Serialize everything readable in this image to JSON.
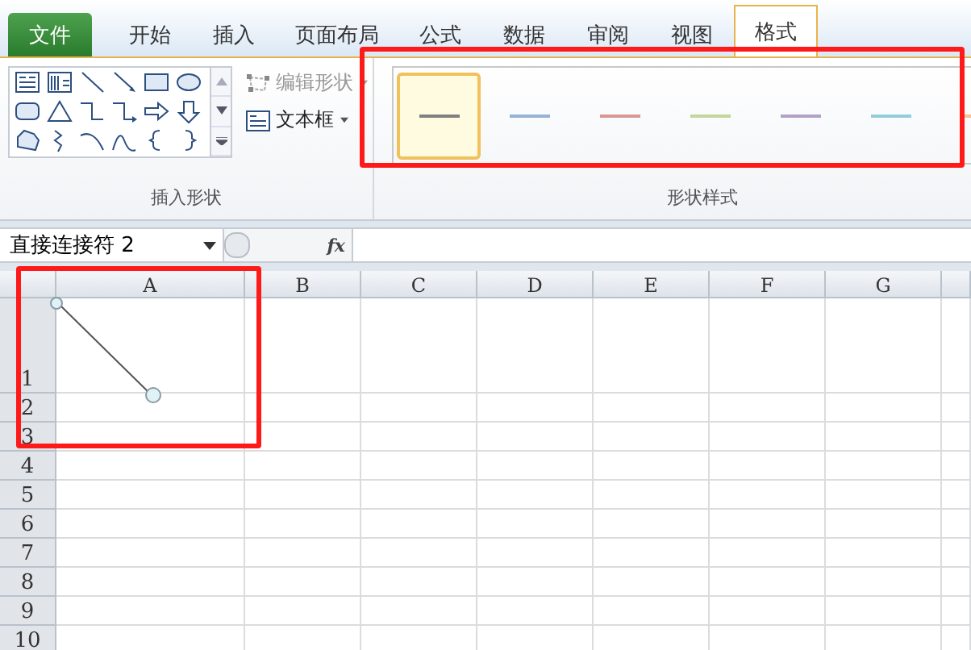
{
  "tabs": [
    {
      "label": "文件",
      "kind": "file",
      "selected": false
    },
    {
      "label": "开始",
      "kind": "tab",
      "selected": false
    },
    {
      "label": "插入",
      "kind": "tab",
      "selected": false
    },
    {
      "label": "页面布局",
      "kind": "tab",
      "selected": false
    },
    {
      "label": "公式",
      "kind": "tab",
      "selected": false
    },
    {
      "label": "数据",
      "kind": "tab",
      "selected": false
    },
    {
      "label": "审阅",
      "kind": "tab",
      "selected": false
    },
    {
      "label": "视图",
      "kind": "tab",
      "selected": false
    },
    {
      "label": "格式",
      "kind": "tab",
      "selected": true
    }
  ],
  "ribbon": {
    "insert_shapes": {
      "edit_shape": {
        "label": "编辑形状",
        "disabled": true
      },
      "text_box": {
        "label": "文本框"
      },
      "group_label": "插入形状"
    },
    "shape_styles": {
      "styles": [
        {
          "color": "#808080",
          "selected": true
        },
        {
          "color": "#95b3d7",
          "selected": false
        },
        {
          "color": "#d99694",
          "selected": false
        },
        {
          "color": "#c3d69b",
          "selected": false
        },
        {
          "color": "#b2a1c7",
          "selected": false
        },
        {
          "color": "#93cddd",
          "selected": false
        },
        {
          "color": "#fac090",
          "selected": false
        }
      ],
      "group_label": "形状样式"
    }
  },
  "name_box": {
    "value": "直接连接符 2"
  },
  "formula_bar": {
    "function_label": "fx"
  },
  "sheet": {
    "columns": [
      "A",
      "B",
      "C",
      "D",
      "E",
      "F",
      "G"
    ],
    "rows": [
      "1",
      "2",
      "3",
      "4",
      "5",
      "6",
      "7",
      "8",
      "9",
      "10"
    ]
  }
}
